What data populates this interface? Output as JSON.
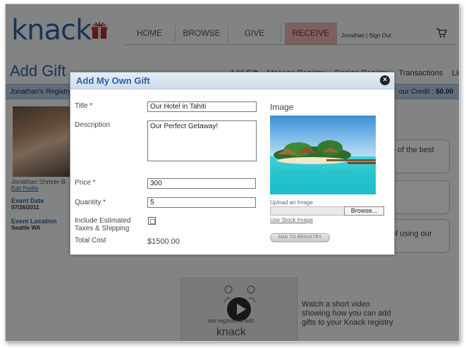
{
  "header": {
    "logo": "knack",
    "nav": [
      "HOME",
      "BROWSE",
      "GIVE",
      "RECEIVE"
    ],
    "user_name": "Jonathan",
    "sign_out": "Sign Out"
  },
  "page": {
    "title": "Add Gift",
    "sub_links": [
      "Add Gift",
      "Manage Registry",
      "Design Registry",
      "Transactions",
      "Links"
    ],
    "registry_name": "Jonathan's Registry",
    "credit_label": "our Credit : ",
    "credit_value": "$0.00"
  },
  "sidebar": {
    "profile_name": "Jonathan Shriver-B",
    "edit_profile": "Edit Profile",
    "event_date_label": "Event Date",
    "event_date": "07/26/2011",
    "event_location_label": "Event Location",
    "event_location": "Seattle WA"
  },
  "right_boxes": [
    "e of the best",
    "",
    "of using our"
  ],
  "video": {
    "caption": "Watch a short video showing how you can add gifts to your Knack registry",
    "thumb_text": "are registered with",
    "thumb_brand": "knack"
  },
  "modal": {
    "title": "Add My Own Gift",
    "close": "×",
    "fields": {
      "title_label": "Title *",
      "title_value": "Our Hotel in Tahiti",
      "description_label": "Description",
      "description_value": "Our Perfect Getaway!",
      "price_label": "Price *",
      "price_value": "300",
      "quantity_label": "Quantity *",
      "quantity_value": "5",
      "shipping_label_1": "Include Estimated",
      "shipping_label_2": "Taxes & Shipping",
      "total_label": "Total Cost",
      "total_value": "$1500.00"
    },
    "image": {
      "heading": "Image",
      "upload_label": "Upload an Image",
      "browse_label": "Browse...",
      "stock_link": "Use Stock Image",
      "add_button": "ADD TO REGISTRY"
    }
  },
  "colors": {
    "brand_blue": "#2a62a6",
    "receive_tab": "#e8b5b5",
    "registry_bar": "#b8cfe7"
  }
}
